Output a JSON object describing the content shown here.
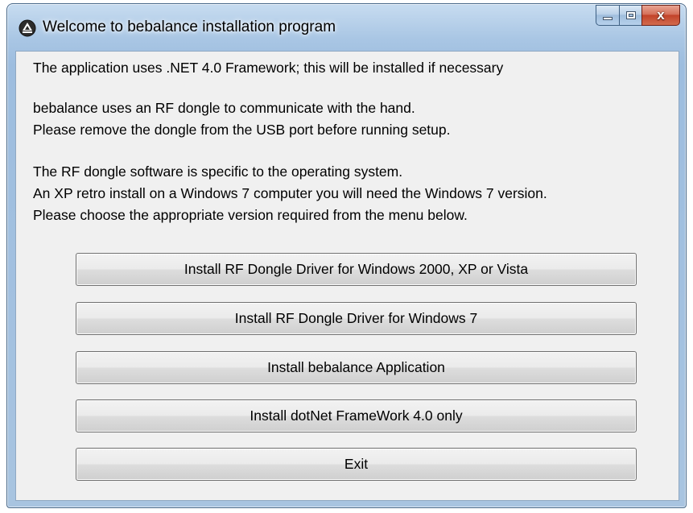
{
  "window": {
    "title": "Welcome to bebalance installation program",
    "title_icon": "app-logo-icon",
    "caption_buttons": {
      "minimize": "minimize-icon",
      "maximize": "maximize-icon",
      "close": "x"
    }
  },
  "messages": {
    "line1": "The application uses .NET 4.0 Framework; this will be installed if necessary",
    "line2": "bebalance uses an RF dongle to communicate with the hand.",
    "line3": "Please remove the dongle from the USB port before running setup.",
    "line4": "The RF dongle software is specific to the operating system.",
    "line5": "An XP retro install on a Windows 7 computer you will need the Windows 7 version.",
    "line6": "Please choose the appropriate version required from the menu below."
  },
  "buttons": [
    {
      "label": "Install RF Dongle Driver for Windows 2000, XP or Vista"
    },
    {
      "label": "Install RF Dongle Driver for Windows 7"
    },
    {
      "label": "Install bebalance Application"
    },
    {
      "label": "Install dotNet FrameWork 4.0 only"
    },
    {
      "label": "Exit"
    }
  ],
  "colors": {
    "frame": "#a9c6e4",
    "client_background": "#f0f0f0",
    "close_button": "#c2432a"
  }
}
